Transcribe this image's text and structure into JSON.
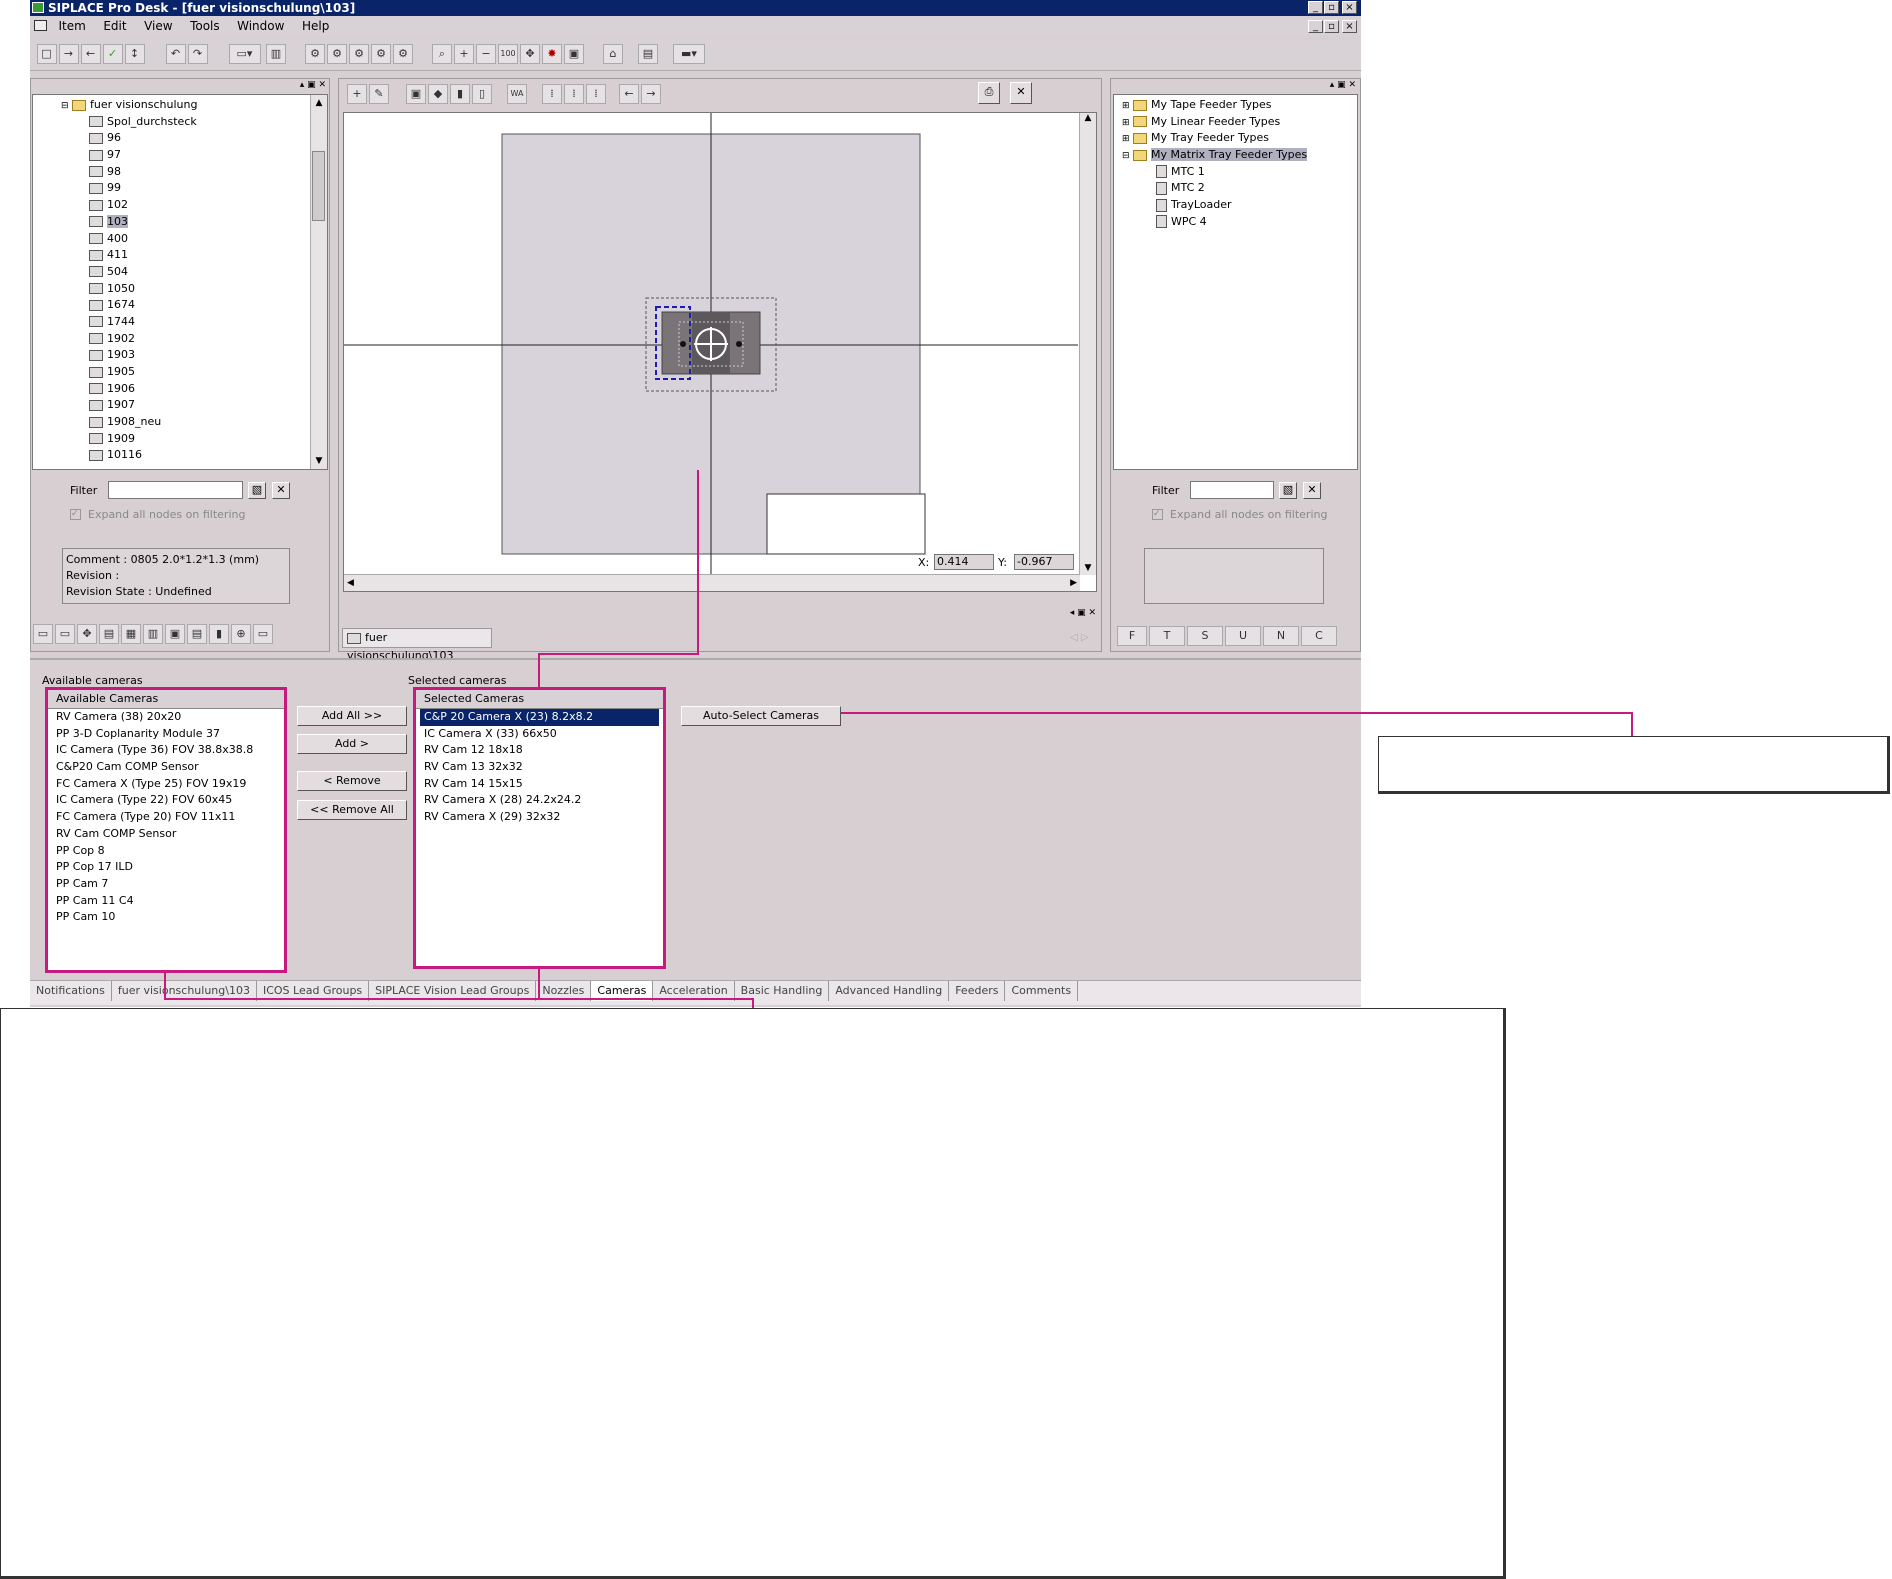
{
  "window": {
    "title": "SIPLACE Pro Desk - [fuer visionschulung\\103]",
    "controls": [
      "_",
      "▫",
      "×"
    ]
  },
  "menu": [
    "Item",
    "Edit",
    "View",
    "Tools",
    "Window",
    "Help"
  ],
  "left_tree": {
    "root": "fuer visionschulung",
    "items": [
      "Spol_durchsteck",
      "96",
      "97",
      "98",
      "99",
      "102",
      "103",
      "400",
      "411",
      "504",
      "1050",
      "1674",
      "1744",
      "1902",
      "1903",
      "1905",
      "1906",
      "1907",
      "1908_neu",
      "1909",
      "10116"
    ],
    "selected": "103"
  },
  "left_filter": {
    "label": "Filter",
    "expand_label": "Expand all nodes on filtering"
  },
  "info": {
    "comment": "Comment : 0805  2.0*1.2*1.3 (mm)",
    "revision": "Revision :",
    "revision_state": "Revision State : Undefined"
  },
  "viewer": {
    "x_label": "X:",
    "x_value": "0.414",
    "y_label": "Y:",
    "y_value": "-0.967",
    "doc_tab": "fuer visionschulung\\103"
  },
  "right_tree": {
    "items": [
      "My Tape Feeder Types",
      "My Linear Feeder Types",
      "My Tray Feeder Types",
      "My Matrix Tray Feeder Types"
    ],
    "children": [
      "MTC 1",
      "MTC 2",
      "TrayLoader",
      "WPC 4"
    ]
  },
  "right_filter": {
    "label": "Filter",
    "expand_label": "Expand all nodes on filtering"
  },
  "right_bottom_tabs": [
    "F",
    "T",
    "S",
    "U",
    "N",
    "C"
  ],
  "cameras": {
    "available_label": "Available cameras",
    "available_header": "Available Cameras",
    "available": [
      "RV Camera (38) 20x20",
      "PP 3-D Coplanarity Module 37",
      "IC Camera (Type 36) FOV 38.8x38.8",
      "C&P20 Cam COMP Sensor",
      "FC Camera X (Type 25) FOV 19x19",
      "IC Camera (Type 22) FOV 60x45",
      "FC Camera (Type 20) FOV 11x11",
      "RV Cam COMP Sensor",
      "PP Cop 8",
      "PP Cop 17 ILD",
      "PP Cam 7",
      "PP Cam 11 C4",
      "PP Cam 10"
    ],
    "selected_label": "Selected cameras",
    "selected_header": "Selected Cameras",
    "selected": [
      "C&P 20 Camera X (23) 8.2x8.2",
      "IC Camera X (33) 66x50",
      "RV Cam 12 18x18",
      "RV Cam 13 32x32",
      "RV Cam 14 15x15",
      "RV Camera X (28) 24.2x24.2",
      "RV Camera X (29) 32x32"
    ],
    "buttons": {
      "add_all": "Add All >>",
      "add": "Add >",
      "remove": "< Remove",
      "remove_all": "<< Remove All",
      "auto_select": "Auto-Select Cameras"
    }
  },
  "bottom_tabs": [
    "Notifications",
    "fuer visionschulung\\103",
    "ICOS Lead Groups",
    "SIPLACE Vision Lead Groups",
    "Nozzles",
    "Cameras",
    "Acceleration",
    "Basic Handling",
    "Advanced Handling",
    "Feeders",
    "Comments"
  ],
  "active_tab": "Cameras",
  "colors": {
    "callout": "#c8197f",
    "titlebar": "#0a246a",
    "window_bg": "#d8cfd3"
  }
}
